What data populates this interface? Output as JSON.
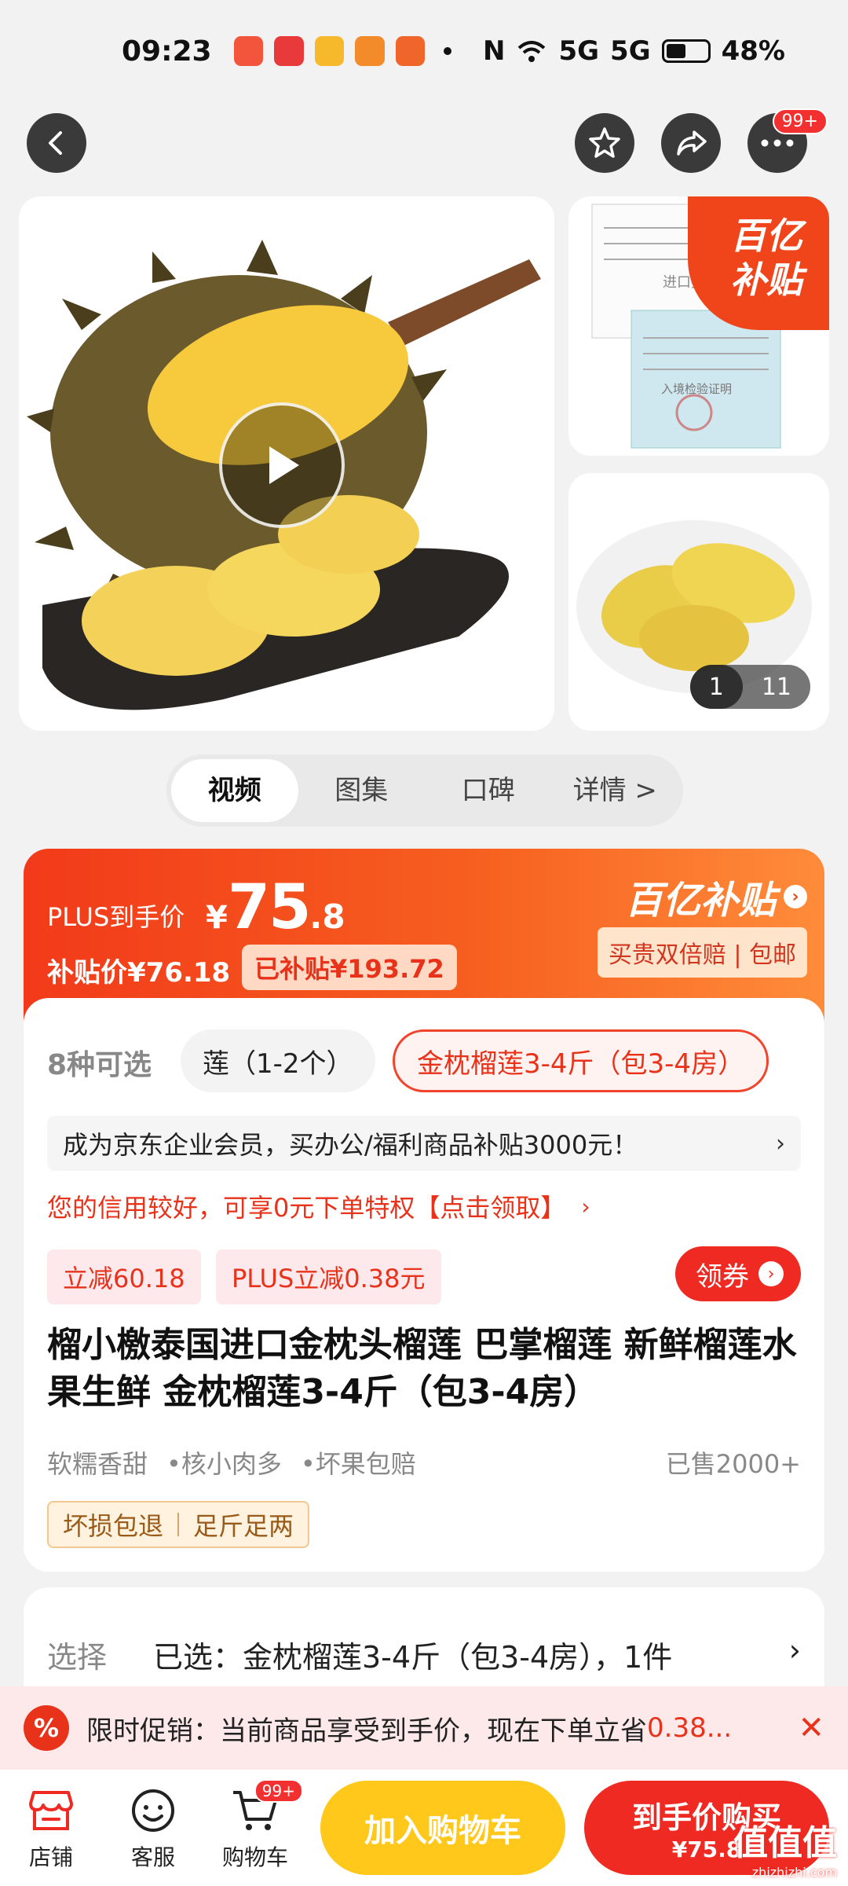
{
  "status_bar": {
    "time": "09:23",
    "battery": "48%",
    "battery_level": 0.48,
    "network_1": "5G",
    "network_2": "5G"
  },
  "top_nav": {
    "more_badge": "99+"
  },
  "gallery": {
    "doc_caption_1": "进口报",
    "doc_caption_2": "入境检验证明",
    "subsidy_badge_line1": "百亿",
    "subsidy_badge_line2": "补贴",
    "counter_current": "1",
    "counter_total": "11"
  },
  "tabs": [
    "视频",
    "图集",
    "口碑",
    "详情 >"
  ],
  "price": {
    "plus_label": "PLUS到手价",
    "currency": "¥",
    "plus_int": "75",
    "plus_dec": ".8",
    "subsidy_price": "补贴价¥76.18",
    "subsidized_amount": "已补贴¥193.72",
    "brand": "百亿补贴",
    "guarantee": "买贵双倍赔 | 包邮"
  },
  "spec": {
    "count": "8种可选",
    "option_partial": "莲（1-2个）",
    "option_selected": "金枕榴莲3-4斤（包3-4房）"
  },
  "enterprise_text": "成为京东企业会员，买办公/福利商品补贴3000元！",
  "credit_text": "您的信用较好，可享0元下单特权【点击领取】",
  "coupons": [
    "立减60.18",
    "PLUS立减0.38元"
  ],
  "get_coupon": "领券",
  "product_title": "榴小檄泰国进口金枕头榴莲 巴掌榴莲 新鲜榴莲水果生鲜 金枕榴莲3-4斤（包3-4房）",
  "features": [
    "软糯香甜",
    "•核小肉多",
    "•坏果包赔"
  ],
  "sold": "已售2000+",
  "tags": [
    "坏损包退",
    "足斤足两"
  ],
  "selection": {
    "label": "选择",
    "value": "已选：金枕榴莲3-4斤（包3-4房），1件",
    "arrow": "›"
  },
  "promo": {
    "prefix": "限时促销：当前商品享受到手价，现在下单立省",
    "amount": "0.38...",
    "icon": "%"
  },
  "bottom": {
    "shop": "店铺",
    "service": "客服",
    "cart": "购物车",
    "cart_badge": "99+",
    "add_cart": "加入购物车",
    "buy_line1": "到手价购买",
    "buy_line2": "¥75.8",
    "watermark": "值值值",
    "watermark_sub": "zhizhizhi.com"
  },
  "colors": {
    "accent": "#ee2a23",
    "yellow": "#ffc81a",
    "orange": "#f65e1f"
  }
}
